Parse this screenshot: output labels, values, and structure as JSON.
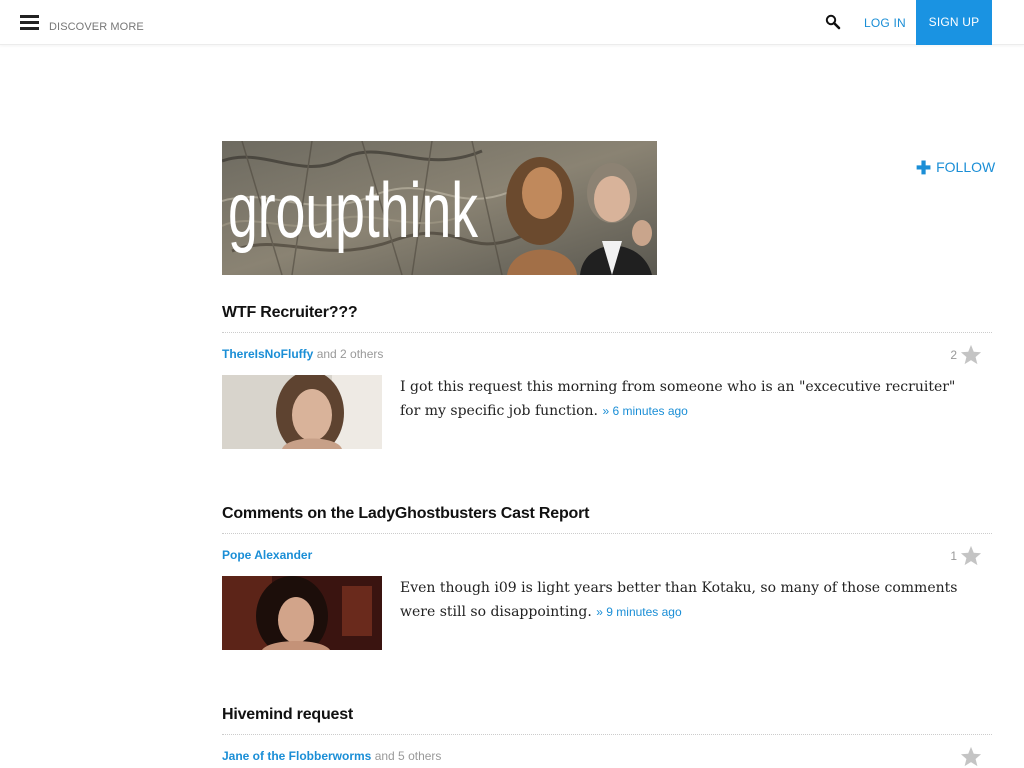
{
  "header": {
    "discover_label": "DISCOVER MORE",
    "login_label": "LOG IN",
    "signup_label": "SIGN UP",
    "accent_color": "#1a93e2"
  },
  "blog": {
    "banner_title": "groupthink",
    "follow_label": "FOLLOW"
  },
  "posts": [
    {
      "title": "WTF Recruiter???",
      "author": "ThereIsNoFluffy",
      "others": "and 2 others",
      "star_count": "2",
      "excerpt": "I got this request this morning from someone who is an \"excecutive recruiter\" for my specific job function.",
      "time": "» 6 minutes ago"
    },
    {
      "title": "Comments on the LadyGhostbusters Cast Report",
      "author": "Pope Alexander",
      "others": "",
      "star_count": "1",
      "excerpt": "Even though i09 is light years better than Kotaku, so many of those comments were still so disappointing.",
      "time": "» 9 minutes ago"
    },
    {
      "title": "Hivemind request",
      "author": "Jane of the Flobberworms",
      "others": "and 5 others",
      "star_count": "",
      "excerpt": "",
      "time": ""
    }
  ]
}
